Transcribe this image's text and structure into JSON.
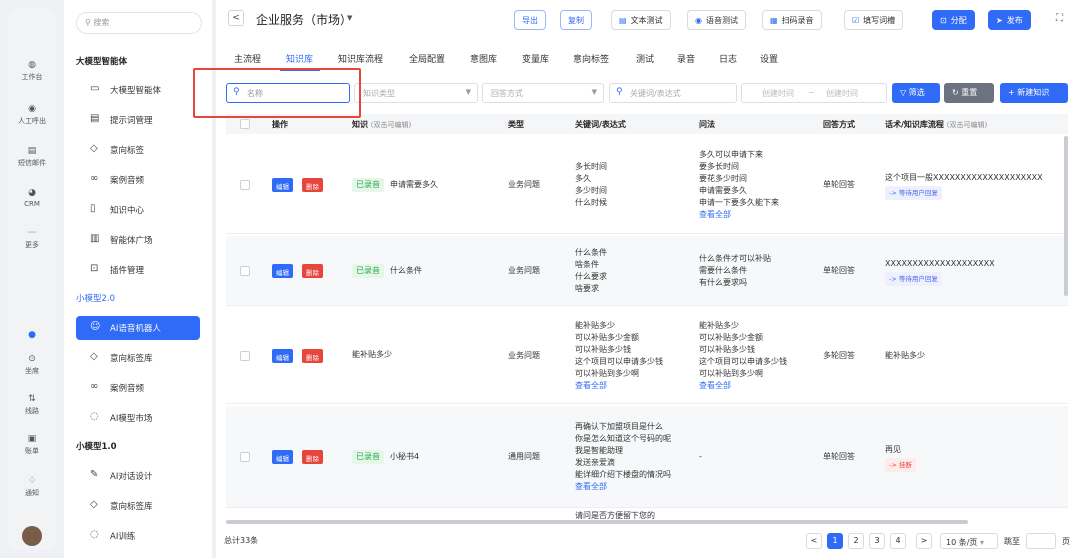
{
  "rail": [
    {
      "icon": "workbench-icon",
      "glyph": "◍",
      "label": "工作台"
    },
    {
      "icon": "call-icon",
      "glyph": "◉",
      "label": "人工呼出"
    },
    {
      "icon": "sms-icon",
      "glyph": "▤",
      "label": "短信邮件"
    },
    {
      "icon": "crm-icon",
      "glyph": "◕",
      "label": "CRM"
    },
    {
      "icon": "more-icon",
      "glyph": "⋯",
      "label": "更多"
    },
    {
      "icon": "seat-icon",
      "glyph": "⊙",
      "label": "坐席"
    },
    {
      "icon": "route-icon",
      "glyph": "⇅",
      "label": "线路"
    },
    {
      "icon": "bill-icon",
      "glyph": "▣",
      "label": "账单"
    },
    {
      "icon": "bell-icon",
      "glyph": "♢",
      "label": "通知"
    }
  ],
  "sidebar": {
    "search_placeholder": "搜索",
    "groups": [
      {
        "label": "大模型智能体"
      },
      {
        "label": "小模型2.0"
      },
      {
        "label": "小模型1.0"
      }
    ],
    "items": [
      {
        "label": "大模型智能体",
        "glyph": "▭"
      },
      {
        "label": "提示词管理",
        "glyph": "▤"
      },
      {
        "label": "意向标签",
        "glyph": "◇"
      },
      {
        "label": "案例音频",
        "glyph": "∞"
      },
      {
        "label": "知识中心",
        "glyph": "▯"
      },
      {
        "label": "智能体广场",
        "glyph": "▥"
      },
      {
        "label": "插件管理",
        "glyph": "⊡"
      },
      {
        "label": "AI语音机器人",
        "glyph": "☺"
      },
      {
        "label": "意向标签库",
        "glyph": "◇"
      },
      {
        "label": "案例音频",
        "glyph": "∞"
      },
      {
        "label": "AI模型市场",
        "glyph": "◌"
      },
      {
        "label": "AI对话设计",
        "glyph": "✎"
      },
      {
        "label": "意向标签库",
        "glyph": "◇"
      },
      {
        "label": "AI训练",
        "glyph": "◌"
      }
    ]
  },
  "header": {
    "back": "<",
    "title": "企业服务（市场）",
    "caret": "▼",
    "buttons": [
      {
        "label": "导出",
        "glyph": ""
      },
      {
        "label": "复制",
        "glyph": ""
      },
      {
        "label": "文本测试",
        "glyph": "▤"
      },
      {
        "label": "语音测试",
        "glyph": "◉"
      },
      {
        "label": "扫码录音",
        "glyph": "▦"
      },
      {
        "label": "填写词槽",
        "glyph": "☑"
      },
      {
        "label": "分配",
        "glyph": "⊡"
      },
      {
        "label": "发布",
        "glyph": "➤"
      }
    ],
    "fullscreen": "⛶"
  },
  "tabs": [
    "主流程",
    "知识库",
    "知识库流程",
    "全局配置",
    "意图库",
    "变量库",
    "意向标签",
    "测试",
    "录音",
    "日志",
    "设置"
  ],
  "active_tab": "知识库",
  "filters": {
    "name_placeholder": "名称",
    "type_placeholder": "知识类型",
    "answer_placeholder": "回答方式",
    "keyword_placeholder": "关键词/表达式",
    "created_from": "创建时间",
    "created_to": "创建时间",
    "range_sep": "~",
    "filter_btn": "筛选",
    "reset_btn": "重置",
    "new_btn": "新建知识"
  },
  "table": {
    "headers": {
      "op": "操作",
      "knowledge": "知识",
      "knowledge_hint": "(双击可编辑)",
      "type": "类型",
      "keywords": "关键词/表达式",
      "questions": "问法",
      "answer": "回答方式",
      "script": "话术/知识库流程",
      "script_hint": "(双击可编辑)"
    },
    "edit_label": "编辑",
    "delete_label": "删除",
    "rows": [
      {
        "recorded": "已录音",
        "name": "申请需要多久",
        "type": "业务问题",
        "keywords": [
          "多长时间",
          "多久",
          "多少时间",
          "什么时候"
        ],
        "keywords_more": "",
        "questions": [
          "多久可以申请下来",
          "要多长时间",
          "要花多少时间",
          "申请需要多久",
          "申请一下要多久能下来"
        ],
        "questions_more": "查看全部",
        "answer": "单轮回答",
        "script": "这个项目一般XXXXXXXXXXXXXXXXXXXX",
        "script_tag": "-> 等待用户回复",
        "tag_kind": "wait"
      },
      {
        "recorded": "已录音",
        "name": "什么条件",
        "type": "业务问题",
        "keywords": [
          "什么条件",
          "啥条件",
          "什么要求",
          "啥要求"
        ],
        "keywords_more": "",
        "questions": [
          "什么条件才可以补贴",
          "需要什么条件",
          "有什么要求吗"
        ],
        "questions_more": "",
        "answer": "单轮回答",
        "script": "XXXXXXXXXXXXXXXXXXXX",
        "script_tag": "-> 等待用户回复",
        "tag_kind": "wait"
      },
      {
        "recorded": "",
        "name": "能补贴多少",
        "type": "业务问题",
        "keywords": [
          "能补贴多少",
          "可以补贴多少金额",
          "可以补贴多少钱",
          "这个项目可以申请多少钱",
          "可以补贴到多少啊"
        ],
        "keywords_more": "查看全部",
        "questions": [
          "能补贴多少",
          "可以补贴多少金额",
          "可以补贴多少钱",
          "这个项目可以申请多少钱",
          "可以补贴到多少啊"
        ],
        "questions_more": "查看全部",
        "answer": "多轮回答",
        "script": "能补贴多少",
        "script_tag": "",
        "tag_kind": ""
      },
      {
        "recorded": "已录音",
        "name": "小秘书4",
        "type": "通用问题",
        "keywords": [
          "再确认下加盟项目是什么",
          "你是怎么知道这个号码的呢",
          "我是智能助理",
          "发送亲爱滴",
          "能详细介绍下楼盘的情况吗"
        ],
        "keywords_more": "查看全部",
        "questions": [
          "-"
        ],
        "questions_more": "",
        "answer": "单轮回答",
        "script": "再见",
        "script_tag": "-> 挂断",
        "tag_kind": "hang"
      }
    ],
    "partial_row_text": "请问是否方便留下您的"
  },
  "footer": {
    "total": "总计33条",
    "prev": "<",
    "pages": [
      "1",
      "2",
      "3",
      "4"
    ],
    "next": ">",
    "page_size": "10 条/页",
    "jump_label": "跳至",
    "page_unit": "页"
  }
}
